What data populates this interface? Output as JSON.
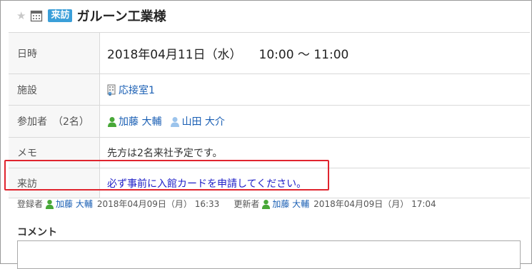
{
  "header": {
    "badge": "来訪",
    "title": "ガルーン工業様"
  },
  "details": {
    "date_label": "日時",
    "date_value": "2018年04月11日（水）",
    "time_value": "10:00 〜 11:00",
    "facility_label": "施設",
    "facility_value": "応接室1",
    "attendees_label": "参加者",
    "attendees_count": "（2名）",
    "attendees": [
      "加藤 大輔",
      "山田 大介"
    ],
    "memo_label": "メモ",
    "memo_value": "先方は2名来社予定です。",
    "visit_label": "来訪",
    "visit_value": "必ず事前に入館カードを申請してください。"
  },
  "meta": {
    "registrant_label": "登録者",
    "registrant_name": "加藤 大輔",
    "registered_at": "2018年04月09日（月） 16:33",
    "updater_label": "更新者",
    "updater_name": "加藤 大輔",
    "updated_at": "2018年04月09日（月） 17:04"
  },
  "comment": {
    "label": "コメント"
  },
  "colors": {
    "badge_bg": "#3b9fd9",
    "link": "#1a5fb4",
    "highlight_border": "#e0242e",
    "visit_text": "#2020c8"
  }
}
